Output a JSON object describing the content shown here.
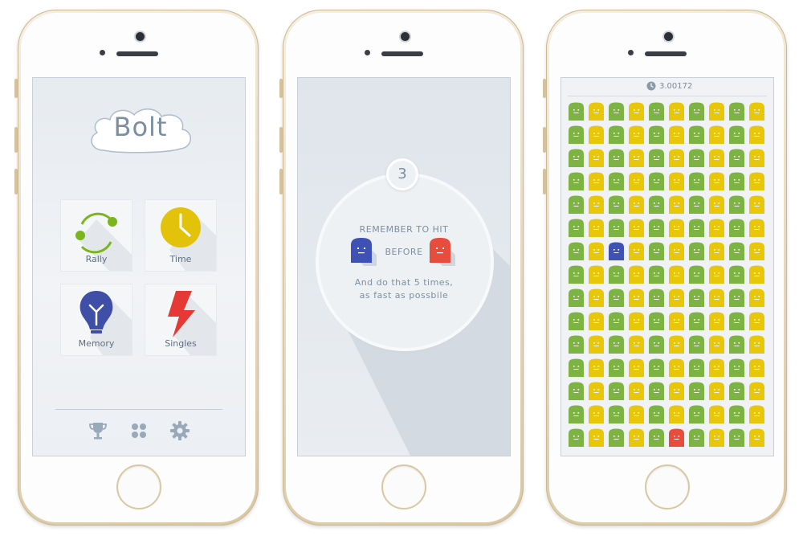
{
  "colors": {
    "green": "#7cb342",
    "yellow": "#e8c60a",
    "blue": "#3f51b5",
    "red": "#e74c3c",
    "time_clock": "#e3c20c",
    "memory_bulb": "#3f4fa8",
    "singles_bolt": "#e53935",
    "rally_arrows": "#7ab51d"
  },
  "home_screen": {
    "logo_text": "Bolt",
    "modes": [
      {
        "label": "Rally",
        "icon": "rally-arrows-icon"
      },
      {
        "label": "Time",
        "icon": "clock-icon"
      },
      {
        "label": "Memory",
        "icon": "bulb-icon"
      },
      {
        "label": "Singles",
        "icon": "lightning-icon"
      }
    ],
    "bottom_nav": [
      {
        "icon": "trophy-icon"
      },
      {
        "icon": "grid-icon"
      },
      {
        "icon": "gear-icon"
      }
    ]
  },
  "intro_screen": {
    "countdown": "3",
    "line1": "REMEMBER TO  HIT",
    "line2": "BEFORE",
    "line3": "And do that 5 times,",
    "line4": "as fast as possbile"
  },
  "game_screen": {
    "timer": "3.00172",
    "grid": [
      "GYGYGYGYGY",
      "GYGYGYGYGY",
      "GYGYGYGYGY",
      "GYGYGYGYGY",
      "GYGYGYGYGY",
      "GYGYGYGYGY",
      "GYBYGYGYGY",
      "GYGYGYGYGY",
      "GYGYGYGYGY",
      "GYGYGYGYGY",
      "GYGYGYGYGY",
      "GYGYGYGYGY",
      "GYGYGYGYGY",
      "GYGYGYGYGY",
      "GYGYGRGYGY"
    ]
  }
}
